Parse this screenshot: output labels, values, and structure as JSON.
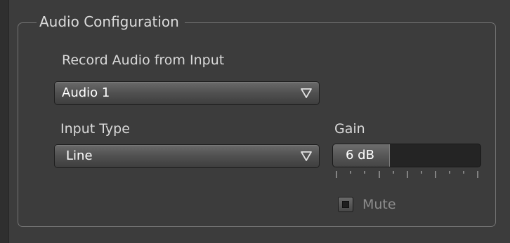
{
  "audio_config": {
    "group_title": "Audio Configuration",
    "record_label": "Record Audio from Input",
    "record_input": {
      "value": "Audio 1"
    },
    "input_type_label": "Input Type",
    "input_type": {
      "value": "Line"
    },
    "gain": {
      "label": "Gain",
      "value_text": "6 dB",
      "fill_fraction": 0.38
    },
    "mute": {
      "label": "Mute",
      "checked": false,
      "enabled": false
    }
  },
  "icons": {
    "dropdown_arrow": "chevron-down-icon"
  },
  "colors": {
    "background": "#3c3c3c",
    "frame_border": "#737373",
    "text": "#d9d9d9",
    "disabled_text": "#8c8c8c"
  }
}
